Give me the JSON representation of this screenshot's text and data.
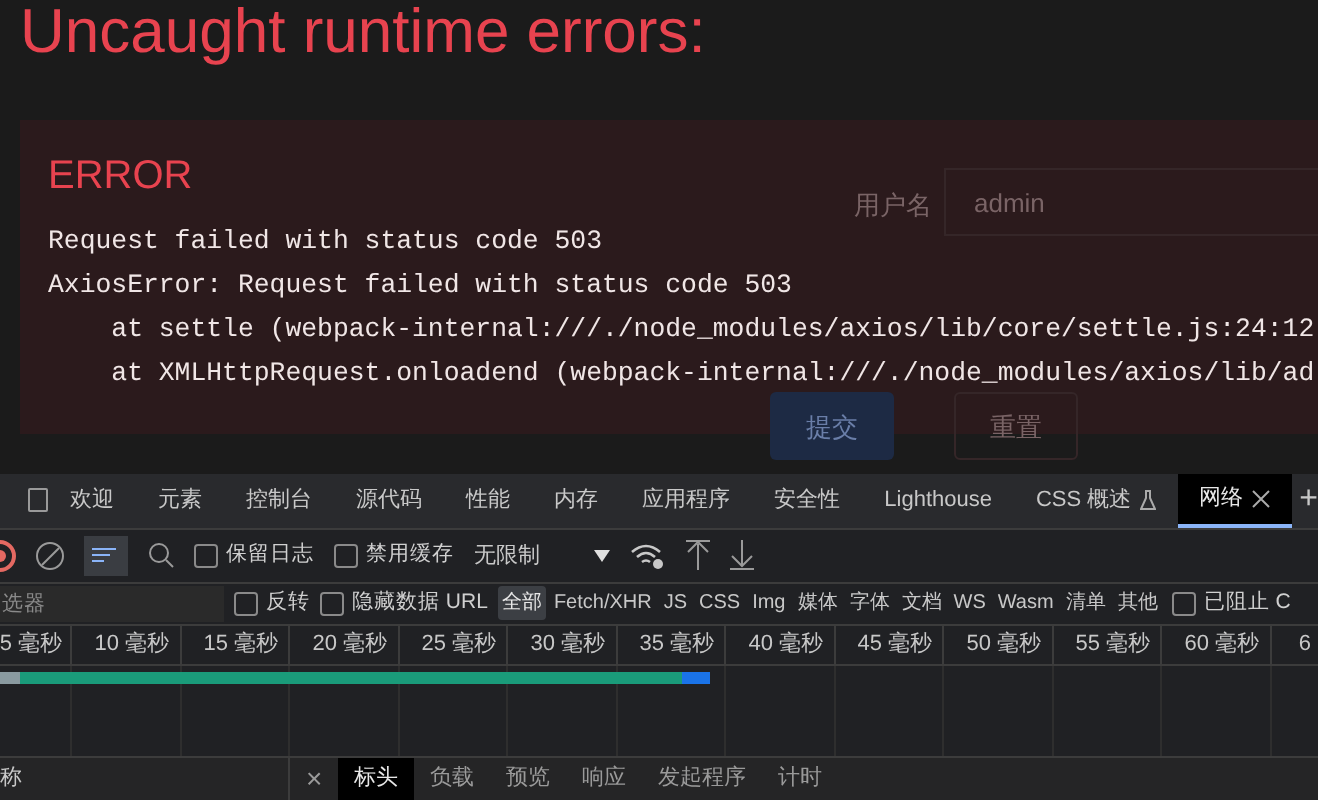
{
  "overlay": {
    "title": "Uncaught runtime errors:",
    "error_label": "ERROR",
    "lines": [
      "Request failed with status code 503",
      "AxiosError: Request failed with status code 503",
      "    at settle (webpack-internal:///./node_modules/axios/lib/core/settle.js:24:12",
      "    at XMLHttpRequest.onloadend (webpack-internal:///./node_modules/axios/lib/ad"
    ]
  },
  "background_form": {
    "username_label": "用户名",
    "username_value": "admin",
    "buttons": [
      "提交",
      "重置"
    ]
  },
  "devtools": {
    "tabs": [
      {
        "label": "欢迎",
        "selected": false
      },
      {
        "label": "元素",
        "selected": false
      },
      {
        "label": "控制台",
        "selected": false
      },
      {
        "label": "源代码",
        "selected": false
      },
      {
        "label": "性能",
        "selected": false
      },
      {
        "label": "内存",
        "selected": false
      },
      {
        "label": "应用程序",
        "selected": false
      },
      {
        "label": "安全性",
        "selected": false
      },
      {
        "label": "Lighthouse",
        "selected": false
      },
      {
        "label": "CSS 概述",
        "selected": false,
        "experimental": true
      },
      {
        "label": "网络",
        "selected": true,
        "closable": true
      }
    ],
    "add_tab": "+",
    "toolbar": {
      "preserve_log": {
        "label": "保留日志",
        "checked": false
      },
      "disable_cache": {
        "label": "禁用缓存",
        "checked": false
      },
      "throttling": "无限制",
      "filter_active": true
    },
    "filter": {
      "placeholder": "选器",
      "invert": {
        "label": "反转",
        "checked": false
      },
      "hide_data_urls": {
        "label": "隐藏数据 URL",
        "checked": false
      },
      "types": [
        {
          "label": "全部",
          "selected": true
        },
        {
          "label": "Fetch/XHR",
          "selected": false
        },
        {
          "label": "JS",
          "selected": false
        },
        {
          "label": "CSS",
          "selected": false
        },
        {
          "label": "Img",
          "selected": false
        },
        {
          "label": "媒体",
          "selected": false
        },
        {
          "label": "字体",
          "selected": false
        },
        {
          "label": "文档",
          "selected": false
        },
        {
          "label": "WS",
          "selected": false
        },
        {
          "label": "Wasm",
          "selected": false
        },
        {
          "label": "清单",
          "selected": false
        },
        {
          "label": "其他",
          "selected": false
        }
      ],
      "blocked": {
        "label": "已阻止 C",
        "checked": false
      }
    },
    "timeline_ticks": [
      "5 毫秒",
      "10 毫秒",
      "15 毫秒",
      "20 毫秒",
      "25 毫秒",
      "30 毫秒",
      "35 毫秒",
      "40 毫秒",
      "45 毫秒",
      "50 毫秒",
      "55 毫秒",
      "60 毫秒",
      "6"
    ],
    "name_column": "称",
    "close": "×",
    "detail_tabs": [
      {
        "label": "标头",
        "selected": true
      },
      {
        "label": "负载",
        "selected": false
      },
      {
        "label": "预览",
        "selected": false
      },
      {
        "label": "响应",
        "selected": false
      },
      {
        "label": "发起程序",
        "selected": false
      },
      {
        "label": "计时",
        "selected": false
      }
    ]
  }
}
